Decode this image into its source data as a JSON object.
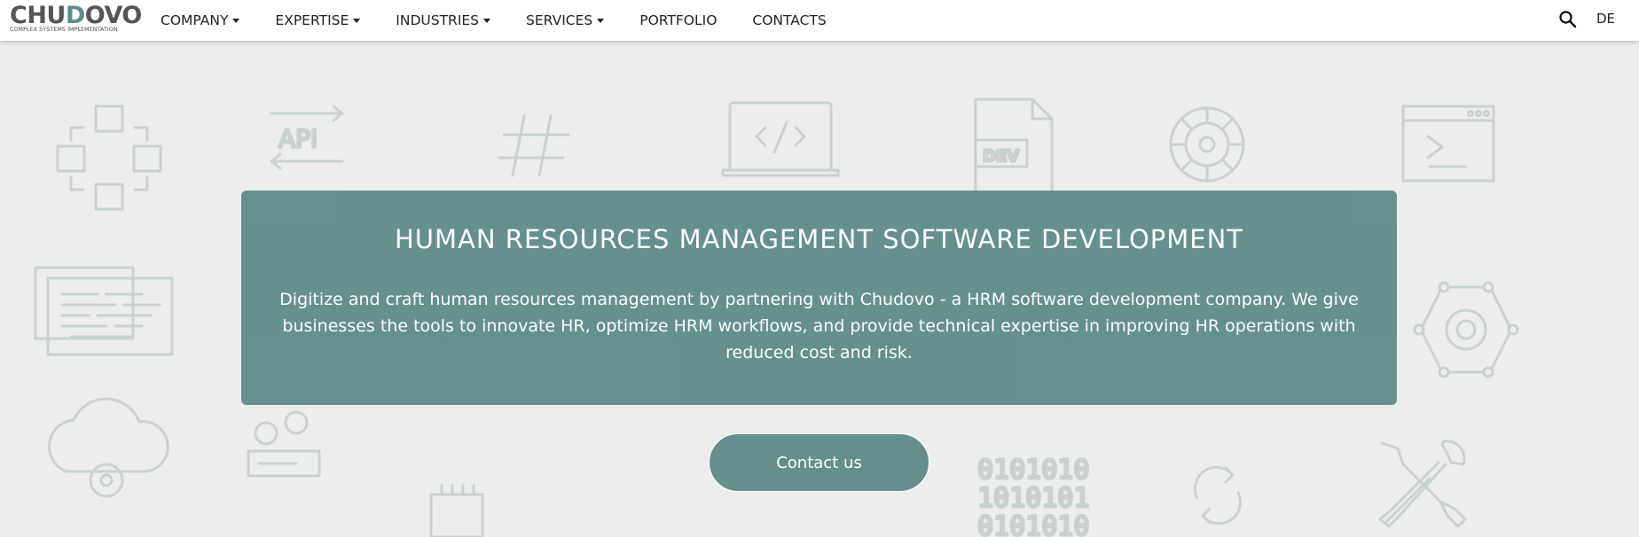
{
  "brand": {
    "name_part1": "CHU",
    "name_accent": "D",
    "name_part2": "OVO",
    "tagline": "COMPLEX SYSTEMS IMPLEMENTATION"
  },
  "nav": {
    "items": [
      {
        "label": "COMPANY",
        "has_dropdown": true
      },
      {
        "label": "EXPERTISE",
        "has_dropdown": true
      },
      {
        "label": "INDUSTRIES",
        "has_dropdown": true
      },
      {
        "label": "SERVICES",
        "has_dropdown": true
      },
      {
        "label": "PORTFOLIO",
        "has_dropdown": false
      },
      {
        "label": "CONTACTS",
        "has_dropdown": false
      }
    ],
    "search_icon": "search-icon",
    "language": "DE"
  },
  "hero": {
    "title": "HUMAN RESOURCES MANAGEMENT SOFTWARE DEVELOPMENT",
    "description": "Digitize and craft human resources management by partnering with Chudovo - a HRM software development company. We give businesses the tools to innovate HR, optimize HRM workflows, and provide technical expertise in improving HR operations with reduced cost and risk."
  },
  "cta": {
    "label": "Contact us"
  },
  "background": {
    "api_label": "API",
    "dev_label": "DEV",
    "binary_rows": [
      "0101010",
      "1010101",
      "0101010"
    ]
  },
  "colors": {
    "accent": "#648f8c",
    "background": "#ececec",
    "icon_stroke": "#c9d1cf"
  }
}
